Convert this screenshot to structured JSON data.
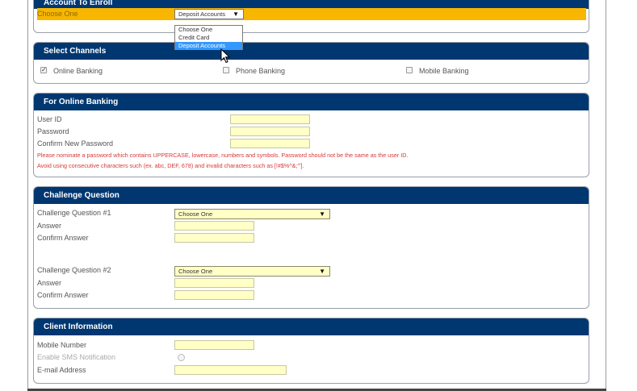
{
  "enroll": {
    "header": "Account To Enroll",
    "choose_label": "Choose One",
    "select_value": "Deposit Accounts",
    "options": [
      "Choose One",
      "Credit Card",
      "Deposit Accounts"
    ]
  },
  "channels": {
    "header": "Select Channels",
    "online": "Online Banking",
    "phone": "Phone Banking",
    "mobile": "Mobile Banking"
  },
  "online_banking": {
    "header": "For Online Banking",
    "user_id": "User ID",
    "password": "Password",
    "confirm_password": "Confirm New Password",
    "note1": "Please nominate a password which contains UPPERCASE, lowercase, numbers and symbols. Password should not be the same as the user ID.",
    "note2": "Avoid using consecutive characters such (ex. abc, DEF, 678) and invalid characters such as [!#$%^&;'\"]."
  },
  "challenge": {
    "header": "Challenge Question",
    "q1_label": "Challenge Question #1",
    "q1_value": "Choose One",
    "answer1": "Answer",
    "confirm1": "Confirm Answer",
    "q2_label": "Challenge Question #2",
    "q2_value": "Choose One",
    "answer2": "Answer",
    "confirm2": "Confirm Answer"
  },
  "client": {
    "header": "Client Information",
    "mobile": "Mobile Number",
    "sms": "Enable SMS Notification",
    "email": "E-mail Address"
  }
}
